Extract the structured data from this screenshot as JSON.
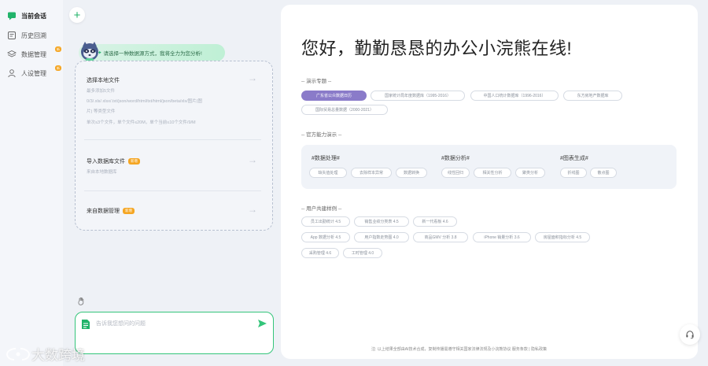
{
  "sidebar": {
    "items": [
      {
        "label": "当前会话"
      },
      {
        "label": "历史回溯"
      },
      {
        "label": "数据管理",
        "badge": "新"
      },
      {
        "label": "人设管理",
        "badge": "新"
      }
    ]
  },
  "chat": {
    "greeting": "请选择一种数据源方式，我将全力为您分析!",
    "local_file": {
      "title": "选择本地文件",
      "desc": [
        "最多添加5文件",
        "0/3/.xls/.xlsx/.txt/json/word/html/txt/html/json/beta/xls/图片(图",
        "片) 等类型文件",
        "单次≤3个文件，单个文件≤20M，单个当前≤10个文件/9/M"
      ]
    },
    "db_file": {
      "title": "导入数据库文件",
      "badge": "新增",
      "desc": "来自本地数据库"
    },
    "data_manage": {
      "title": "来自数据管理",
      "badge": "新增"
    },
    "input": {
      "placeholder": "告诉我您想问的问题"
    }
  },
  "main": {
    "hero": "您好，勤勤恳恳的办公小浣熊在线!",
    "topics": {
      "label": "-- 演示专题 --",
      "chips": [
        "广东省公众数据日历",
        "国家统计局年度数据库（1995-2016）",
        "中国人口统计数据库（1996-2016）",
        "东方房地产数据库",
        "国际贸易总量数据（2000-2021）"
      ]
    },
    "abilities": {
      "label": "-- 官方能力演示 --",
      "groups": [
        {
          "title": "#数据处理#",
          "chips": [
            "缺失值处理",
            "去除样本异常",
            "数据转换"
          ]
        },
        {
          "title": "#数据分析#",
          "chips": [
            "线性回归",
            "相关性分析",
            "聚类分析"
          ]
        },
        {
          "title": "#图表生成#",
          "chips": [
            "折线图",
            "散点图"
          ]
        }
      ]
    },
    "cases": {
      "label": "-- 用户共建样例 --",
      "chips": [
        "员工出勤统计 4.5",
        "销售业绩分类表 4.5",
        "新一代看板 4.6",
        "App 数据分析 4.5",
        "用户指数走势图 4.0",
        "商品GMV 分析 3.8",
        "iPhone 销量分析 3.6",
        "房屋面积指标分析 4.5",
        "采购管理 4.6",
        "工时管理 4.0"
      ]
    },
    "footnote": "注: 以上结果全部由AI技术合成，复制传播需遵守相关国家法律法规及小浣熊协议 服务条款 | 隐私政策"
  },
  "watermark": "大数跨境",
  "colors": {
    "accent": "#21b36a",
    "chip_active": "#8a7bc9",
    "badge": "#f5a623"
  }
}
